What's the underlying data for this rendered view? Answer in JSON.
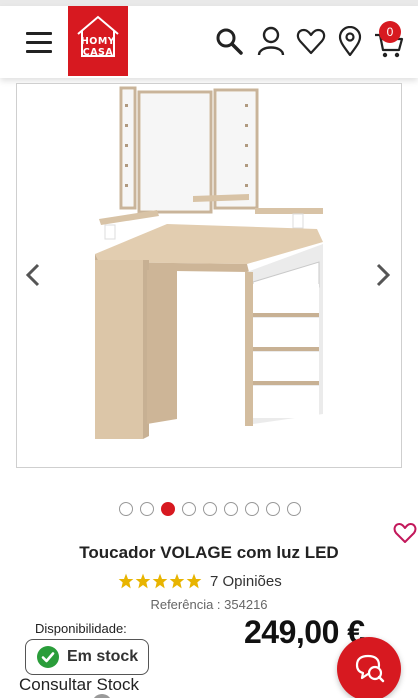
{
  "header": {
    "logo_line1": "HOMY",
    "logo_line2": "CASA",
    "cart_count": "0",
    "icons": [
      "menu-icon",
      "search-icon",
      "user-icon",
      "heart-icon",
      "location-pin-icon",
      "cart-icon"
    ]
  },
  "gallery": {
    "image": "corner-vanity-dressing-table-photo",
    "prev_icon": "chevron-left-icon",
    "next_icon": "chevron-right-icon",
    "slide_count": 9,
    "active_slide": 3
  },
  "product": {
    "title": "Toucador VOLAGE com luz LED",
    "rating_stars": 5,
    "reviews": "7 Opiniões",
    "reference": "Referência : 354216",
    "availability_label": "Disponibilidade:",
    "stock_status": "Em stock",
    "consult_stock": "Consultar Stock",
    "price": "249,00 €"
  },
  "colors": {
    "brand": "#d71920",
    "stock_green": "#2a9d3a",
    "star": "#e8b400"
  }
}
